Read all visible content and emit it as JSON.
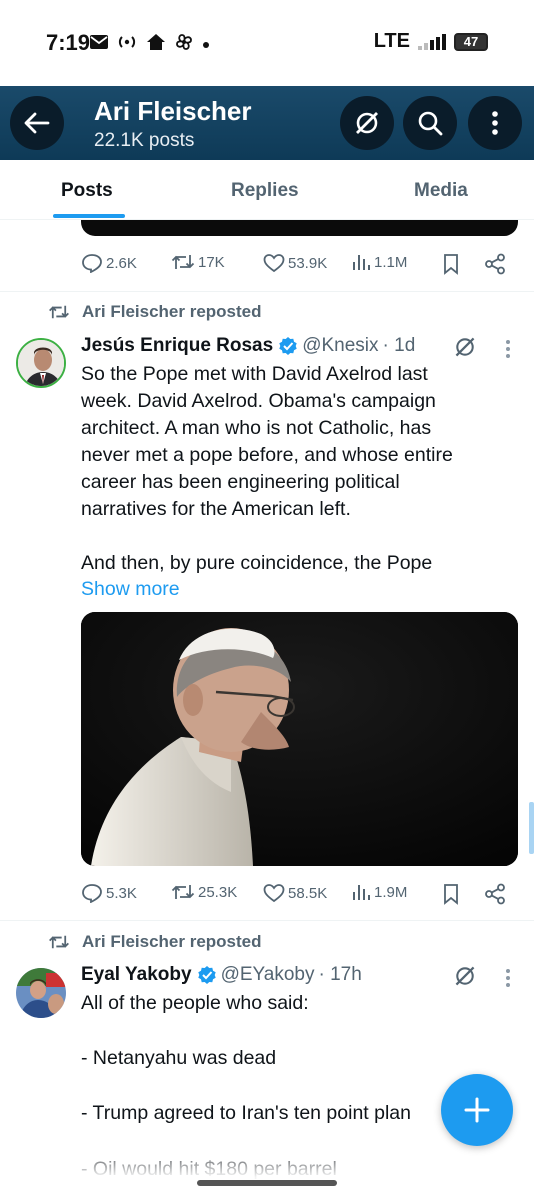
{
  "status_bar": {
    "time": "7:19",
    "network": "LTE",
    "battery": "47",
    "icons": [
      "mail-icon",
      "radio-icon",
      "home-icon",
      "pinwheel-icon",
      "dot-icon"
    ]
  },
  "header": {
    "title": "Ari Fleischer",
    "subtitle": "22.1K posts"
  },
  "tabs": [
    {
      "label": "Posts",
      "active": true
    },
    {
      "label": "Replies",
      "active": false
    },
    {
      "label": "Media",
      "active": false
    }
  ],
  "prev_post": {
    "actions": {
      "replies": "2.6K",
      "reposts": "17K",
      "likes": "53.9K",
      "views": "1.1M"
    }
  },
  "posts": [
    {
      "repost_label": "Ari Fleischer reposted",
      "author": "Jesús Enrique Rosas",
      "handle": "@Knesix",
      "time": "· 1d",
      "text": "So the Pope met with David Axelrod last\nweek. David Axelrod. Obama's campaign\narchitect. A man who is not Catholic, has\nnever met a pope before, and whose entire\ncareer has been engineering political\nnarratives for the American left.\n\nAnd then, by pure coincidence, the Pope",
      "show_more": "Show more",
      "actions": {
        "replies": "5.3K",
        "reposts": "25.3K",
        "likes": "58.5K",
        "views": "1.9M"
      }
    },
    {
      "repost_label": "Ari Fleischer reposted",
      "author": "Eyal Yakoby",
      "handle": "@EYakoby",
      "time": "· 17h",
      "text": "All of the people who said:\n\n- Netanyahu was dead\n\n- Trump agreed to Iran's ten point plan\n\n- Oil would hit $180 per barrel"
    }
  ],
  "colors": {
    "accent": "#1d9bf0",
    "header_bg": "#0e3a57",
    "muted": "#536471"
  }
}
